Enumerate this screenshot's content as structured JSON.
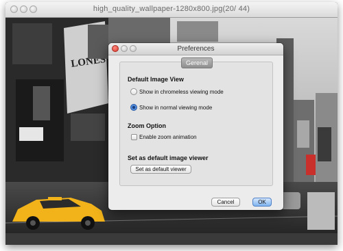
{
  "window": {
    "title": "high_quality_wallpaper-1280x800.jpg(20/ 44)"
  },
  "photo": {
    "sign_text": "LONES"
  },
  "dialog": {
    "title": "Preferences",
    "tab": "Gerenal",
    "sections": {
      "view": {
        "heading": "Default Image View",
        "options": [
          {
            "label": "Show in chromeless viewing mode",
            "selected": false
          },
          {
            "label": "Show in normal viewing mode",
            "selected": true
          }
        ]
      },
      "zoom": {
        "heading": "Zoom Option",
        "checkbox_label": "Enable zoom animation",
        "checked": false
      },
      "default_viewer": {
        "heading": "Set as default image viewer",
        "button_label": "Set as default viewer"
      }
    },
    "cancel_label": "Cancel",
    "ok_label": "OK"
  },
  "colors": {
    "taxi": "#f2b31a",
    "close_button": "#d8382d",
    "ok_button": "#7fb3ee"
  }
}
